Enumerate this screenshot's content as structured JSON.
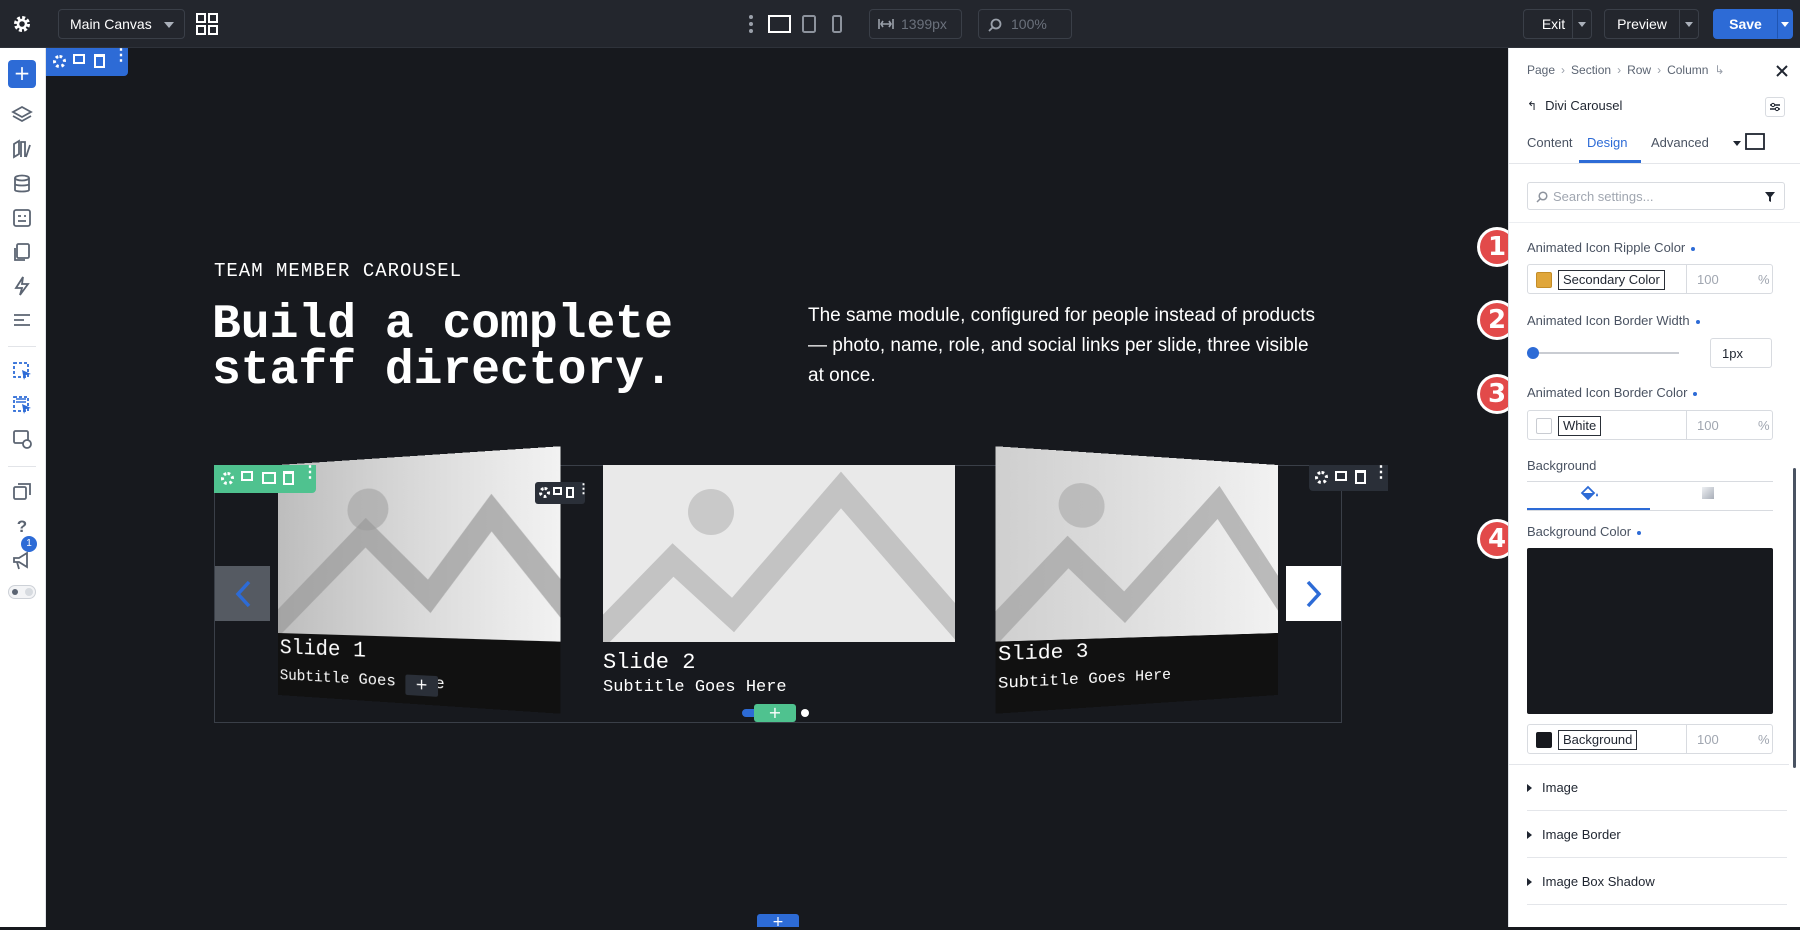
{
  "topbar": {
    "canvas_select": "Main Canvas",
    "width_value": "1399px",
    "zoom_value": "100%",
    "exit_label": "Exit",
    "preview_label": "Preview",
    "save_label": "Save"
  },
  "leftbar": {
    "notification_count": "1"
  },
  "canvas": {
    "eyebrow": "TEAM MEMBER CAROUSEL",
    "heading_line1": "Build a complete",
    "heading_line2": "staff directory.",
    "description": "The same module, configured for people instead of products — photo, name, role, and social links per slide, three visible at once.",
    "slides": [
      {
        "title": "Slide 1",
        "subtitle": "Subtitle Goes Here"
      },
      {
        "title": "Slide 2",
        "subtitle": "Subtitle Goes Here"
      },
      {
        "title": "Slide 3",
        "subtitle": "Subtitle Goes Here"
      }
    ]
  },
  "panel": {
    "breadcrumb": [
      "Page",
      "Section",
      "Row",
      "Column"
    ],
    "module_title": "Divi Carousel",
    "tabs": [
      "Content",
      "Design",
      "Advanced"
    ],
    "active_tab": "Design",
    "search_placeholder": "Search settings...",
    "ripple_label": "Animated Icon Ripple Color",
    "ripple_color_name": "Secondary Color",
    "ripple_swatch": "#e0a63a",
    "ripple_opacity": "100",
    "border_width_label": "Animated Icon Border Width",
    "border_width_value": "1px",
    "border_color_label": "Animated Icon Border Color",
    "border_color_name": "White",
    "border_opacity": "100",
    "background_label": "Background",
    "bg_color_label": "Background Color",
    "bg_color_name": "Background",
    "bg_swatch": "#17191e",
    "bg_opacity": "100",
    "percent": "%",
    "accordions": [
      "Image",
      "Image Border",
      "Image Box Shadow"
    ]
  },
  "badges": [
    "1",
    "2",
    "3",
    "4"
  ],
  "colors": {
    "accent": "#2d6bd6",
    "module_green": "#4fc28f",
    "badge_red": "#e24a4a"
  }
}
